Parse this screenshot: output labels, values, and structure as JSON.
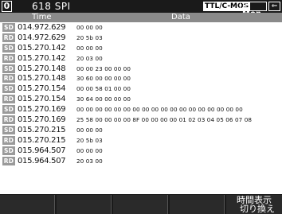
{
  "header": {
    "channel": "0",
    "title": "618  SPI",
    "level": "TTL/C-MOS",
    "mode_label": "Mon"
  },
  "columns": {
    "time": "Time",
    "data": "Data"
  },
  "rows": [
    {
      "dir": "SD",
      "time": "014.972.629",
      "data": "00 00 00"
    },
    {
      "dir": "RD",
      "time": "014.972.629",
      "data": "20 5b 03"
    },
    {
      "dir": "SD",
      "time": "015.270.142",
      "data": "00 00 00"
    },
    {
      "dir": "RD",
      "time": "015.270.142",
      "data": "20 03 00"
    },
    {
      "dir": "SD",
      "time": "015.270.148",
      "data": "00 00 23 00 00 00"
    },
    {
      "dir": "RD",
      "time": "015.270.148",
      "data": "30 60 00 00 00 00"
    },
    {
      "dir": "SD",
      "time": "015.270.154",
      "data": "00 00 58 01 00 00"
    },
    {
      "dir": "RD",
      "time": "015.270.154",
      "data": "30 64 00 00 00 00"
    },
    {
      "dir": "SD",
      "time": "015.270.169",
      "data": "00 00 00 00 00 00 00 00 00 00 00 00 00 00 00 00 00 00"
    },
    {
      "dir": "RD",
      "time": "015.270.169",
      "data": "25 58 00 00 00 00 8F 00 00 00 00 01 02 03 04 05 06 07 08"
    },
    {
      "dir": "SD",
      "time": "015.270.215",
      "data": "00 00 00"
    },
    {
      "dir": "RD",
      "time": "015.270.215",
      "data": "20 5b 03"
    },
    {
      "dir": "SD",
      "time": "015.964.507",
      "data": "00 00 00"
    },
    {
      "dir": "RD",
      "time": "015.964.507",
      "data": "20 03 00"
    }
  ],
  "function_keys": {
    "f6_line1": "時間表示",
    "f6_line2": "切り換え"
  }
}
